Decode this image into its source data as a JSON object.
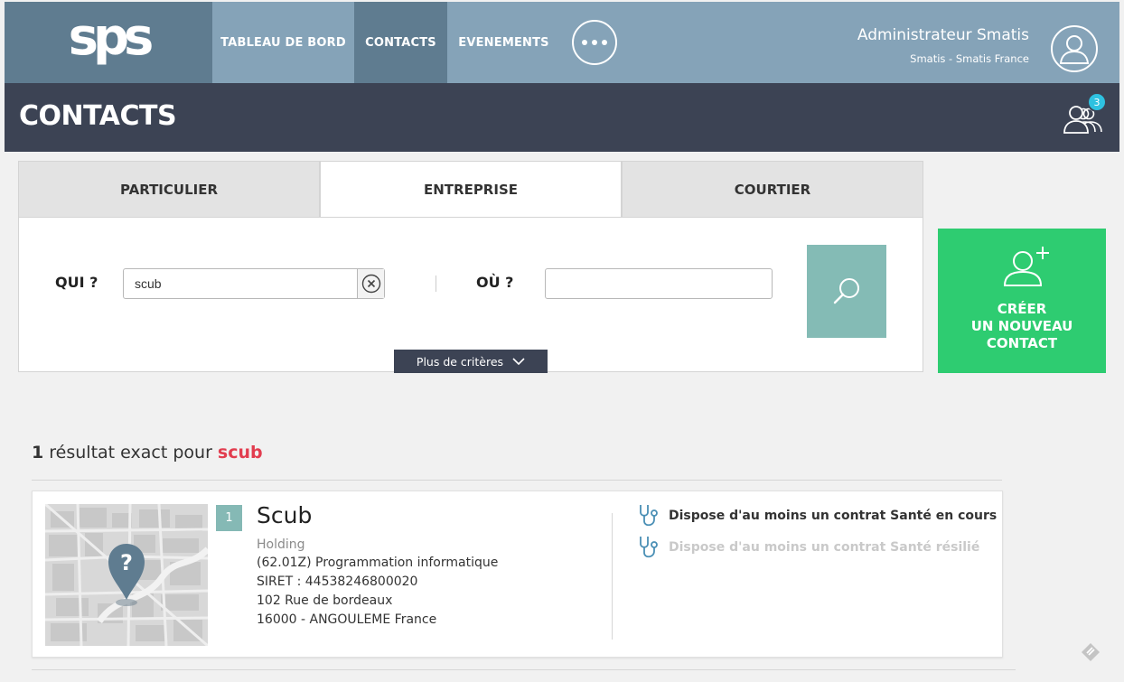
{
  "header": {
    "logo": "sps",
    "nav": {
      "dashboard": "TABLEAU DE BORD",
      "contacts": "CONTACTS",
      "events": "EVENEMENTS"
    },
    "user": {
      "name": "Administrateur Smatis",
      "org": "Smatis - Smatis France"
    }
  },
  "titlebar": {
    "title": "CONTACTS",
    "notif_count": "3"
  },
  "search": {
    "tabs": [
      "PARTICULIER",
      "ENTREPRISE",
      "COURTIER"
    ],
    "active_tab": "ENTREPRISE",
    "who_label": "QUI ?",
    "who_value": "scub",
    "where_label": "OÙ ?",
    "where_value": "",
    "more_criteria": "Plus de critères"
  },
  "create": {
    "line1": "CRÉER",
    "line2": "UN NOUVEAU",
    "line3": "CONTACT"
  },
  "results": {
    "count": "1",
    "text": " résultat exact pour ",
    "term": "scub",
    "items": [
      {
        "index": "1",
        "name": "Scub",
        "type": "Holding",
        "activity": "(62.01Z) Programmation informatique",
        "siret": "SIRET : 44538246800020",
        "street": "102 Rue de bordeaux",
        "city": "16000 - ANGOULEME France",
        "contracts": [
          {
            "label": "Dispose d'au moins un contrat Santé en cours",
            "active": true
          },
          {
            "label": "Dispose d'au moins un contrat Santé résilié",
            "active": false
          }
        ]
      }
    ]
  },
  "colors": {
    "topbar": "#85a3b8",
    "topbar_active": "#5f7c90",
    "titlebar": "#3c4354",
    "create": "#2ecc71",
    "search_btn": "#84bbb5",
    "highlight": "#e23d4f",
    "badge": "#2ec1e0"
  }
}
